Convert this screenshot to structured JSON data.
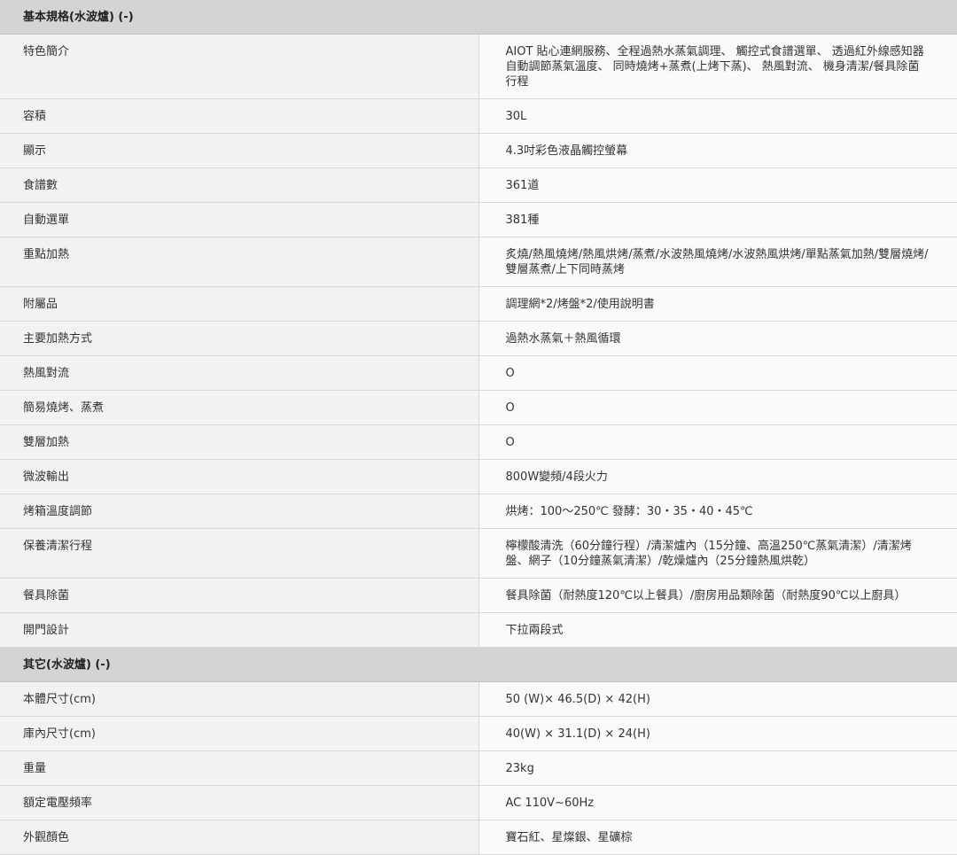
{
  "sections": [
    {
      "title": "基本規格(水波爐) (-)",
      "rows": [
        {
          "label": "特色簡介",
          "value": "AIOT 貼心連網服務、全程過熱水蒸氣調理、 觸控式食譜選單、 透過紅外線感知器自動調節蒸氣溫度、 同時燒烤+蒸煮(上烤下蒸)、 熱風對流、 機身清潔/餐具除菌行程"
        },
        {
          "label": "容積",
          "value": "30L"
        },
        {
          "label": "顯示",
          "value": "4.3吋彩色液晶觸控螢幕"
        },
        {
          "label": "食譜數",
          "value": "361道"
        },
        {
          "label": "自動選單",
          "value": "381種"
        },
        {
          "label": "重點加熱",
          "value": "炙燒/熱風燒烤/熱風烘烤/蒸煮/水波熱風燒烤/水波熱風烘烤/單點蒸氣加熱/雙層燒烤/雙層蒸煮/上下同時蒸烤"
        },
        {
          "label": "附屬品",
          "value": "調理網*2/烤盤*2/使用說明書"
        },
        {
          "label": "主要加熱方式",
          "value": "過熱水蒸氣＋熱風循環"
        },
        {
          "label": "熱風對流",
          "value": "O"
        },
        {
          "label": "簡易燒烤、蒸煮",
          "value": "O"
        },
        {
          "label": "雙層加熱",
          "value": "O"
        },
        {
          "label": "微波輸出",
          "value": "800W變頻/4段火力"
        },
        {
          "label": "烤箱溫度調節",
          "value": "烘烤：100～250℃ 發酵：30・35・40・45℃"
        },
        {
          "label": "保養清潔行程",
          "value": "檸檬酸清洗（60分鐘行程）/清潔爐內（15分鐘、高溫250℃蒸氣清潔）/清潔烤盤、網子（10分鐘蒸氣清潔）/乾燥爐內（25分鐘熱風烘乾）"
        },
        {
          "label": "餐具除菌",
          "value": "餐具除菌（耐熱度120℃以上餐具）/廚房用品類除菌（耐熱度90℃以上廚具）"
        },
        {
          "label": "開門設計",
          "value": "下拉兩段式"
        }
      ]
    },
    {
      "title": "其它(水波爐) (-)",
      "rows": [
        {
          "label": "本體尺寸(cm)",
          "value": "50 (W)× 46.5(D) × 42(H)"
        },
        {
          "label": "庫內尺寸(cm)",
          "value": "40(W) × 31.1(D) × 24(H)"
        },
        {
          "label": "重量",
          "value": "23kg"
        },
        {
          "label": "額定電壓頻率",
          "value": "AC 110V~60Hz"
        },
        {
          "label": "外觀顏色",
          "value": "寶石紅、星燦銀、星礦棕"
        }
      ]
    }
  ]
}
